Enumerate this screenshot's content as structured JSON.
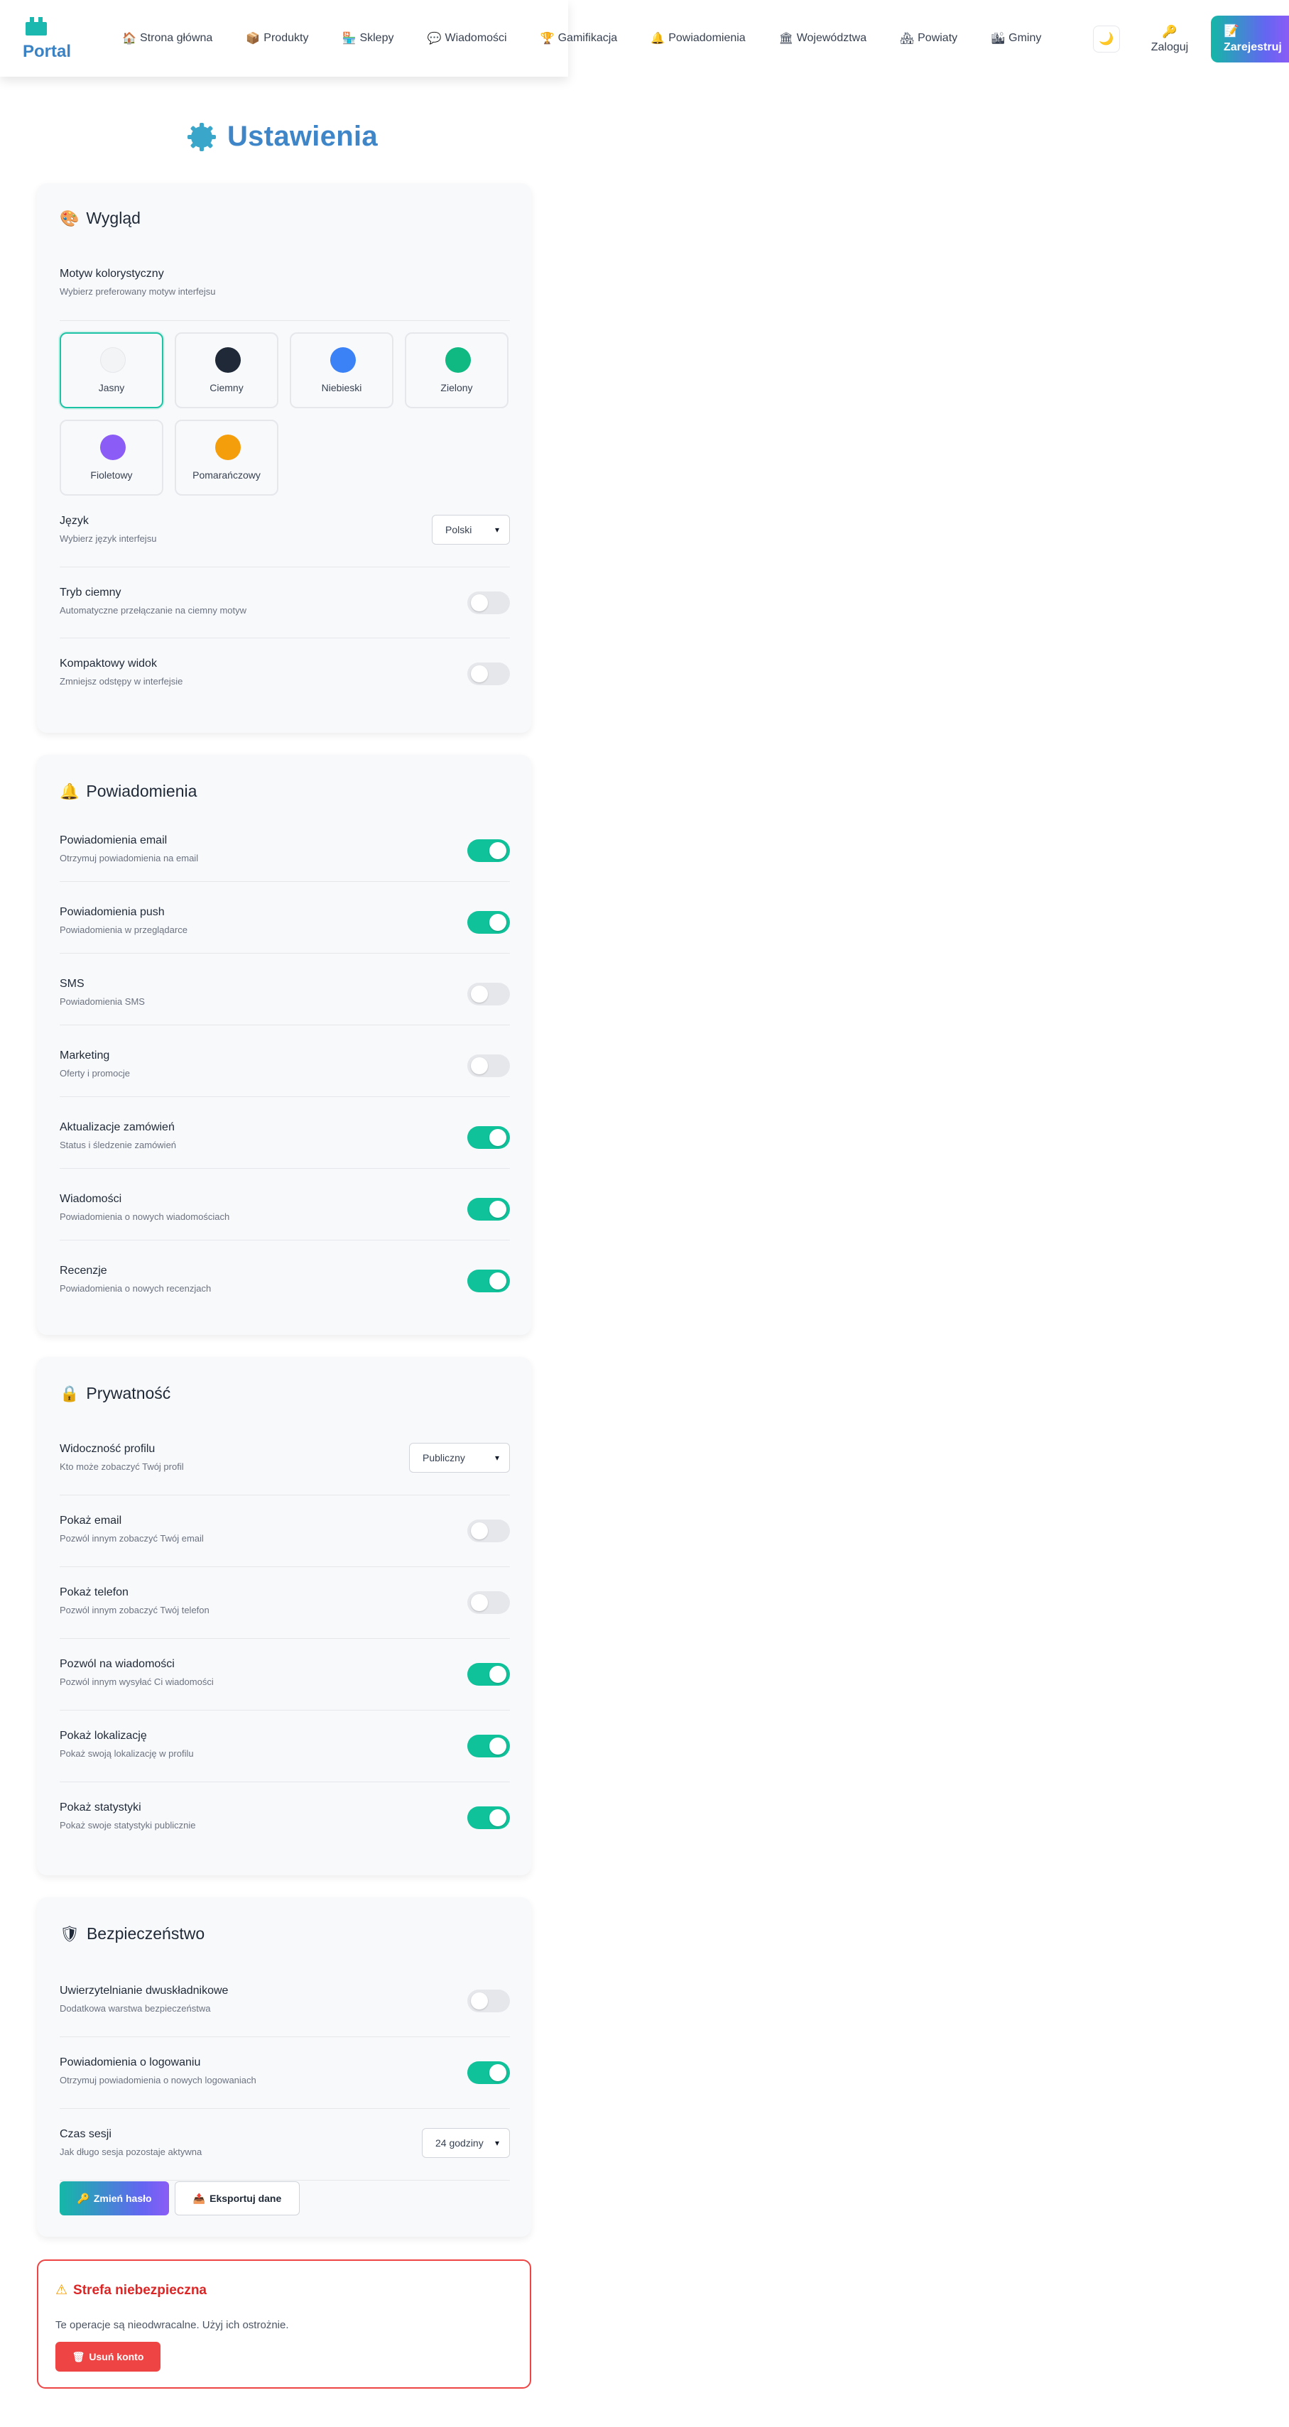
{
  "header": {
    "logo": "Portal",
    "nav": [
      {
        "icon": "home-icon",
        "glyph": "🏠",
        "label": "Strona główna"
      },
      {
        "icon": "package-icon",
        "glyph": "📦",
        "label": "Produkty"
      },
      {
        "icon": "store-icon",
        "glyph": "🏪",
        "label": "Sklepy"
      },
      {
        "icon": "speech-bubble-icon",
        "glyph": "💬",
        "label": "Wiadomości"
      },
      {
        "icon": "trophy-icon",
        "glyph": "🏆",
        "label": "Gamifikacja"
      },
      {
        "icon": "bell-icon",
        "glyph": "🔔",
        "label": "Powiadomienia"
      },
      {
        "icon": "bank-icon",
        "glyph": "🏛",
        "label": "Województwa"
      },
      {
        "icon": "houses-icon",
        "glyph": "🏘",
        "label": "Powiaty"
      },
      {
        "icon": "city-icon",
        "glyph": "🏙",
        "label": "Gminy"
      }
    ],
    "theme_glyph": "🌙",
    "login_label": "Zaloguj",
    "login_glyph": "🔑",
    "register_label": "Zarejestruj",
    "register_glyph": "📝"
  },
  "page_title": "Ustawienia",
  "appearance": {
    "title": "Wygląd",
    "title_glyph": "🎨",
    "theme_label": "Motyw kolorystyczny",
    "theme_sub": "Wybierz preferowany motyw interfejsu",
    "themes": [
      {
        "label": "Jasny",
        "color": "#f3f4f6",
        "selected": true
      },
      {
        "label": "Ciemny",
        "color": "#1f2937",
        "selected": false
      },
      {
        "label": "Niebieski",
        "color": "#3b82f6",
        "selected": false
      },
      {
        "label": "Zielony",
        "color": "#10b981",
        "selected": false
      },
      {
        "label": "Fioletowy",
        "color": "#8b5cf6",
        "selected": false
      },
      {
        "label": "Pomarańczowy",
        "color": "#f59e0b",
        "selected": false
      }
    ],
    "language_label": "Język",
    "language_sub": "Wybierz język interfejsu",
    "language_value": "Polski",
    "dark_label": "Tryb ciemny",
    "dark_sub": "Automatyczne przełączanie na ciemny motyw",
    "dark_on": false,
    "compact_label": "Kompaktowy widok",
    "compact_sub": "Zmniejsz odstępy w interfejsie",
    "compact_on": false
  },
  "notifications": {
    "title": "Powiadomienia",
    "title_glyph": "🔔",
    "items": [
      {
        "label": "Powiadomienia email",
        "sub": "Otrzymuj powiadomienia na email",
        "on": true
      },
      {
        "label": "Powiadomienia push",
        "sub": "Powiadomienia w przeglądarce",
        "on": true
      },
      {
        "label": "SMS",
        "sub": "Powiadomienia SMS",
        "on": false
      },
      {
        "label": "Marketing",
        "sub": "Oferty i promocje",
        "on": false
      },
      {
        "label": "Aktualizacje zamówień",
        "sub": "Status i śledzenie zamówień",
        "on": true
      },
      {
        "label": "Wiadomości",
        "sub": "Powiadomienia o nowych wiadomościach",
        "on": true
      },
      {
        "label": "Recenzje",
        "sub": "Powiadomienia o nowych recenzjach",
        "on": true
      }
    ]
  },
  "privacy": {
    "title": "Prywatność",
    "title_glyph": "🔒",
    "visibility_label": "Widoczność profilu",
    "visibility_sub": "Kto może zobaczyć Twój profil",
    "visibility_value": "Publiczny",
    "items": [
      {
        "label": "Pokaż email",
        "sub": "Pozwól innym zobaczyć Twój email",
        "on": false
      },
      {
        "label": "Pokaż telefon",
        "sub": "Pozwól innym zobaczyć Twój telefon",
        "on": false
      },
      {
        "label": "Pozwól na wiadomości",
        "sub": "Pozwól innym wysyłać Ci wiadomości",
        "on": true
      },
      {
        "label": "Pokaż lokalizację",
        "sub": "Pokaż swoją lokalizację w profilu",
        "on": true
      },
      {
        "label": "Pokaż statystyki",
        "sub": "Pokaż swoje statystyki publicznie",
        "on": true
      }
    ]
  },
  "security": {
    "title": "Bezpieczeństwo",
    "title_glyph": "🛡",
    "items": [
      {
        "label": "Uwierzytelnianie dwuskładnikowe",
        "sub": "Dodatkowa warstwa bezpieczeństwa",
        "on": false
      },
      {
        "label": "Powiadomienia o logowaniu",
        "sub": "Otrzymuj powiadomienia o nowych logowaniach",
        "on": true
      }
    ],
    "session_label": "Czas sesji",
    "session_sub": "Jak długo sesja pozostaje aktywna",
    "session_value": "24 godziny",
    "change_password": "Zmień hasło",
    "change_password_glyph": "🔑",
    "export_data": "Eksportuj dane",
    "export_data_glyph": "📤"
  },
  "danger": {
    "title": "Strefa niebezpieczna",
    "title_glyph": "⚠",
    "text": "Te operacje są nieodwracalne. Użyj ich ostrożnie.",
    "delete_label": "Usuń konto",
    "delete_glyph": "🗑"
  },
  "colors": {
    "accent": "#10c29a",
    "title_blue": "#3f86c8",
    "danger": "#ef4444"
  }
}
